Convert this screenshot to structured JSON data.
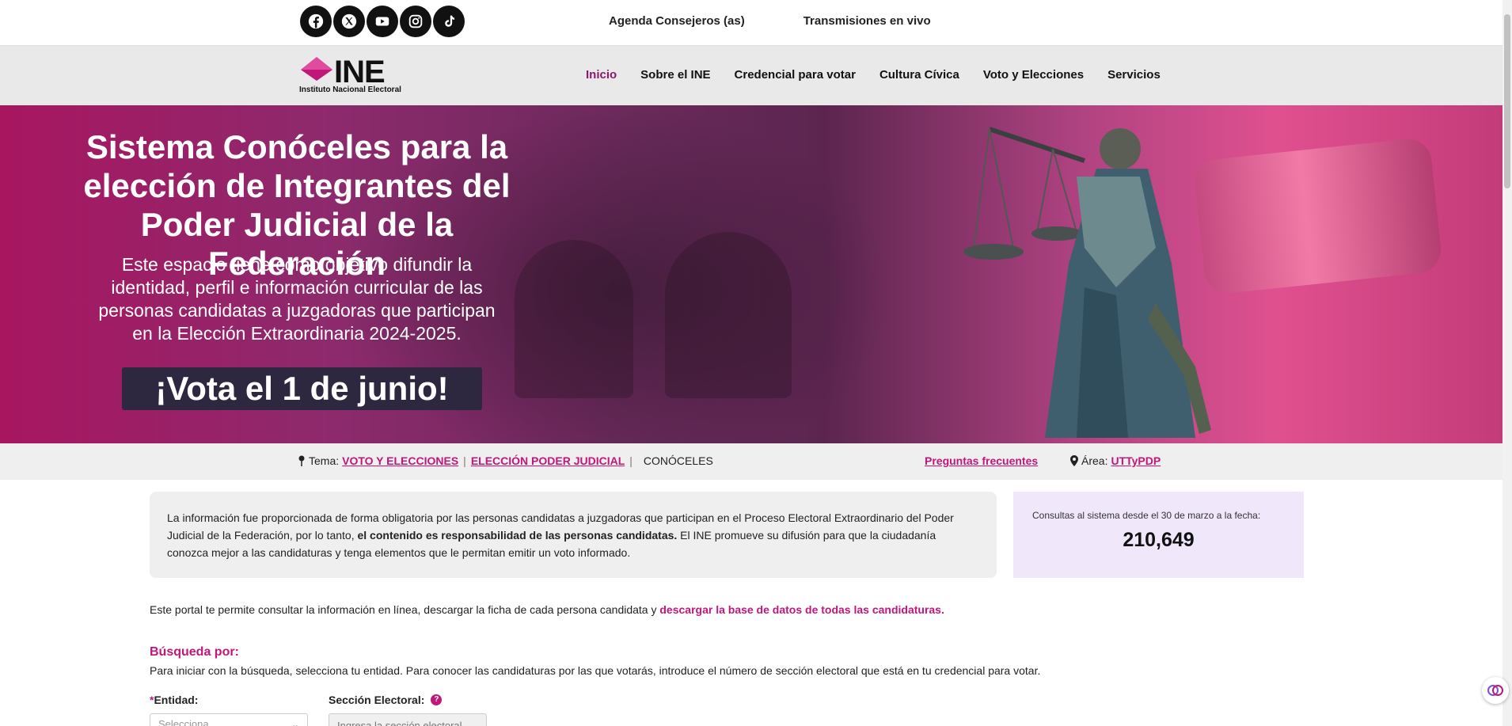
{
  "topbar": {
    "socials": [
      "facebook-icon",
      "x-icon",
      "youtube-icon",
      "instagram-icon",
      "tiktok-icon"
    ],
    "links": [
      "Agenda Consejeros (as)",
      "Transmisiones en vivo"
    ]
  },
  "nav": {
    "logo_text": "INE",
    "logo_sub": "Instituto Nacional Electoral",
    "items": [
      "Inicio",
      "Sobre el INE",
      "Credencial para votar",
      "Cultura Cívica",
      "Voto y Elecciones",
      "Servicios"
    ],
    "active": "Inicio"
  },
  "hero": {
    "title": "Sistema Conóceles para la elección de Integrantes del Poder Judicial de la Federación",
    "description": "Este espacio tiene como objetivo difundir la identidad, perfil e información curricular de las personas candidatas a juzgadoras que participan en la Elección Extraordinaria 2024-2025.",
    "cta": "¡Vota el 1 de junio!"
  },
  "breadcrumb": {
    "tema_label": "Tema:",
    "item1": "VOTO Y ELECCIONES",
    "item2": "ELECCIÓN PODER JUDICIAL",
    "current": "CONÓCELES",
    "faq": "Preguntas frecuentes",
    "area_label": "Área:",
    "area_value": "UTTyPDP"
  },
  "info": {
    "text_before": "La información fue proporcionada de forma obligatoria por las personas candidatas a juzgadoras que participan en el Proceso Electoral Extraordinario del Poder Judicial de la Federación, por lo tanto, ",
    "text_bold": "el contenido es responsabilidad de las personas candidatas.",
    "text_after": " El INE promueve su difusión para que la ciudadanía conozca mejor a las candidaturas y tenga elementos que le permitan emitir un voto informado."
  },
  "counter": {
    "label": "Consultas al sistema desde el 30 de marzo a la fecha:",
    "value": "210,649"
  },
  "portal": {
    "text": "Este portal te permite consultar la información en línea, descargar la ficha de cada persona candidata y ",
    "link": "descargar la base de datos de todas las candidaturas."
  },
  "search": {
    "heading": "Búsqueda por:",
    "description": "Para iniciar con la búsqueda, selecciona tu entidad. Para conocer las candidaturas por las que votarás, introduce el número de sección electoral que está en tu credencial para votar.",
    "entidad_required": "*",
    "entidad_label": "Entidad:",
    "entidad_placeholder": "Selecciona",
    "seccion_label": "Sección Electoral:",
    "seccion_placeholder": "Ingresa la sección electoral"
  },
  "colors": {
    "accent": "#c0177a",
    "active_nav": "#8b1a6c",
    "counter_bg": "#f0e8fa"
  }
}
